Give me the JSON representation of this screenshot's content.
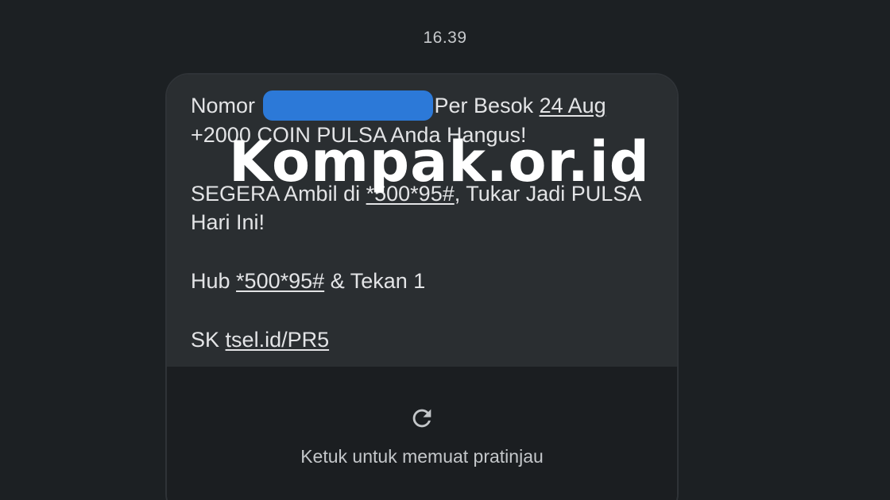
{
  "status": {
    "time": "16.39"
  },
  "message": {
    "line1_prefix": "Nomor",
    "line1_suffix": "Per Besok",
    "date_link": "24 Aug",
    "line2": "+2000 COIN PULSA Anda Hangus!",
    "para2_prefix": "SEGERA Ambil di",
    "ussd_code_1": "*500*95#",
    "para2_suffix": ", Tukar Jadi PULSA Hari Ini!",
    "para3_prefix": "Hub",
    "ussd_code_2": "*500*95#",
    "para3_suffix": "& Tekan 1",
    "para4_prefix": "SK",
    "link": "tsel.id/PR5"
  },
  "preview": {
    "icon": "reload-icon",
    "label": "Ketuk untuk memuat pratinjau"
  },
  "watermark": {
    "text": "Kompak.or.id"
  },
  "colors": {
    "background": "#1c2023",
    "bubble": "#2a2e31",
    "redaction": "#2c79d8"
  }
}
